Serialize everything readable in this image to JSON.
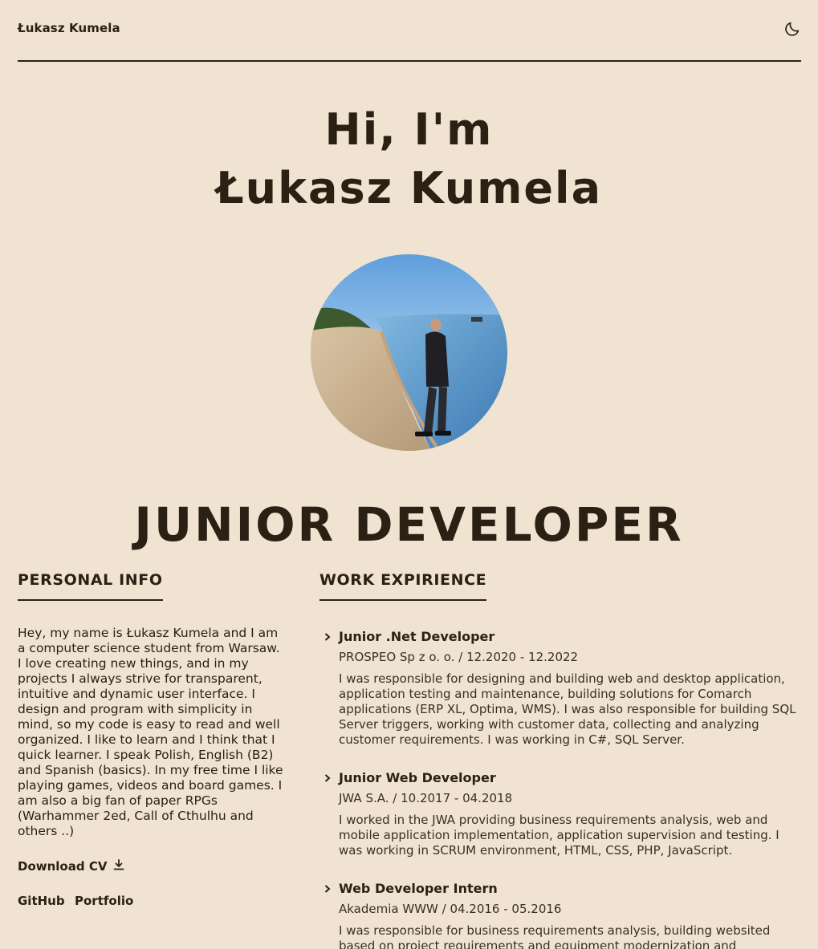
{
  "header": {
    "brand": "Łukasz Kumela",
    "theme_icon": "moon-icon"
  },
  "hero": {
    "greeting": "Hi, I'm",
    "name": "Łukasz Kumela",
    "role": "JUNIOR DEVELOPER"
  },
  "personal": {
    "heading": "PERSONAL INFO",
    "bio": "Hey, my name is Łukasz Kumela and I am a computer science student from Warsaw. I love creating new things, and in my projects I always strive for transparent, intuitive and dynamic user interface. I design and program with simplicity in mind, so my code is easy to read and well organized. I like to learn and I think that I quick learner. I speak Polish, English (B2) and Spanish (basics). In my free time I like playing games, videos and board games. I am also a big fan of paper RPGs (Warhammer 2ed, Call of Cthulhu and others ..)",
    "download_label": "Download CV",
    "links": {
      "github": "GitHub",
      "portfolio": "Portfolio"
    }
  },
  "work": {
    "heading": "WORK EXPIRIENCE",
    "jobs": [
      {
        "title": "Junior .Net Developer",
        "company": "PROSPEO Sp z o. o. / 12.2020 - 12.2022",
        "description": "I was responsible for designing and building web and desktop application, application testing and maintenance, building solutions for Comarch applications (ERP XL, Optima, WMS). I was also responsible for building SQL Server triggers, working with customer data, collecting and analyzing customer requirements. I was working in C#, SQL Server."
      },
      {
        "title": "Junior Web Developer",
        "company": "JWA S.A. / 10.2017 - 04.2018",
        "description": "I worked in the JWA providing business requirements analysis, web and mobile application implementation, application supervision and testing. I was working in SCRUM environment, HTML, CSS, PHP, JavaScript."
      },
      {
        "title": "Web Developer Intern",
        "company": "Akademia WWW / 04.2016 - 05.2016",
        "description": "I was responsible for business requirements analysis, building websited based on project requirements and equipment modernization and"
      }
    ]
  },
  "colors": {
    "background": "#f0e3d1",
    "text": "#2a2114"
  }
}
